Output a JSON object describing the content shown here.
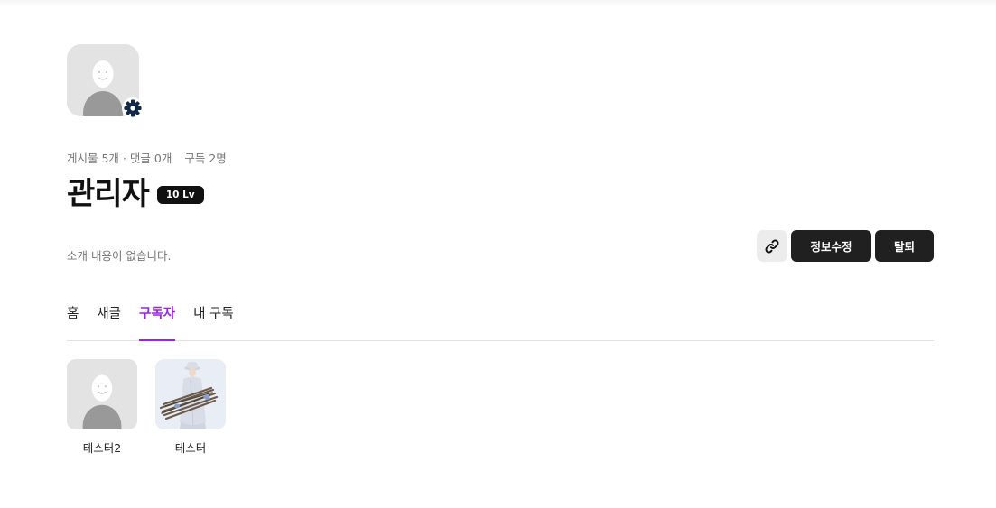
{
  "profile": {
    "stats": {
      "posts": "게시물 5개",
      "separator": "·",
      "comments": "댓글 0개",
      "subscribers": "구독 2명"
    },
    "name": "관리자",
    "level_badge": "10 Lv",
    "intro": "소개 내용이 없습니다.",
    "avatar_icon": "default-avatar-icon",
    "settings_icon": "gear-icon"
  },
  "actions": {
    "link_icon": "link-icon",
    "edit_label": "정보수정",
    "quit_label": "탈퇴"
  },
  "tabs": [
    {
      "label": "홈",
      "active": false
    },
    {
      "label": "새글",
      "active": false
    },
    {
      "label": "구독자",
      "active": true
    },
    {
      "label": "내 구독",
      "active": false
    }
  ],
  "subscribers": [
    {
      "name": "테스터2",
      "image": "default-avatar"
    },
    {
      "name": "테스터",
      "image": "photo-person-with-firewood"
    }
  ],
  "colors": {
    "accent": "#9b22e0",
    "button_dark": "#202020",
    "badge_dark": "#111111",
    "settings_icon": "#10284a"
  }
}
